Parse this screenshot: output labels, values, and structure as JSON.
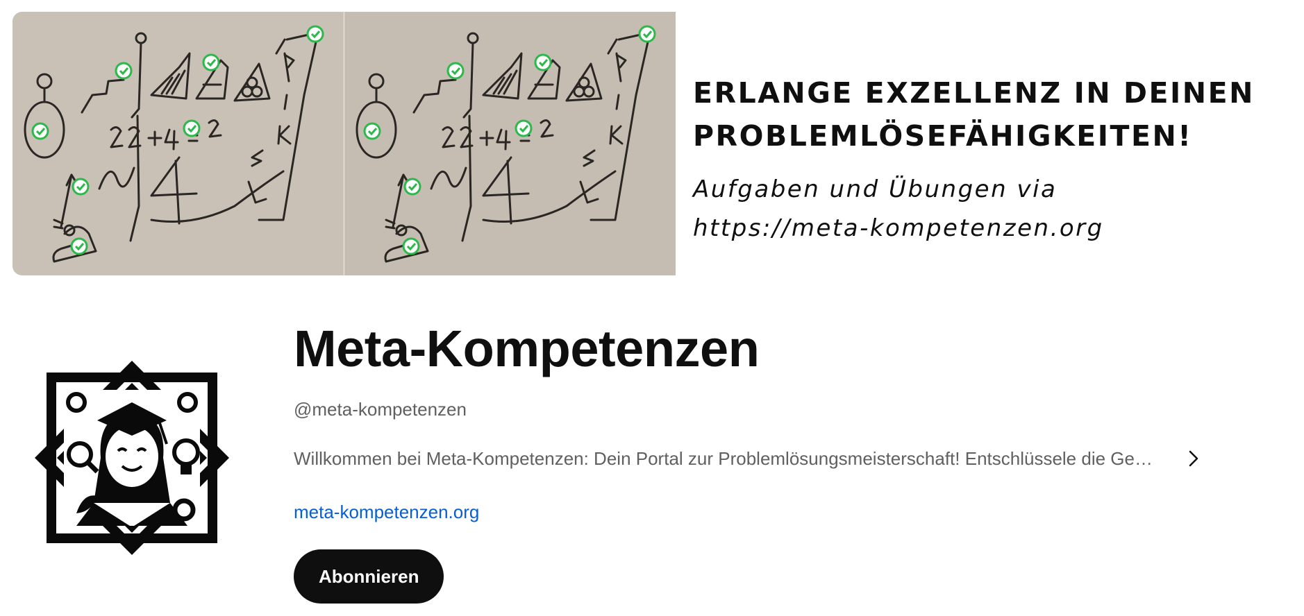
{
  "banner": {
    "headline": "ERLANGE EXZELLENZ IN DEINEN PROBLEMLÖSEFÄHIGKEITEN!",
    "sub_line1": "Aufgaben und Übungen via",
    "sub_line2": "https://meta-kompetenzen.org",
    "sketch_text": "22 + 4 = 2",
    "sketch_letters": [
      "P",
      "I",
      "K",
      "E",
      "L"
    ]
  },
  "channel": {
    "name": "Meta-Kompetenzen",
    "handle": "@meta-kompetenzen",
    "description": "Willkommen bei Meta-Kompetenzen: Dein Portal zur Problemlösungsmeisterschaft! Entschlüssele die Geheimnisse erfolgreicher Problemlösung",
    "link": "meta-kompetenzen.org",
    "subscribe_label": "Abonnieren"
  },
  "colors": {
    "button_bg": "#0f0f0f",
    "link": "#065fd4",
    "secondary_text": "#606060",
    "check_green": "#2db84b",
    "paper": "#c8bfb4"
  },
  "icons": {
    "description_more": "chevron-right-icon",
    "checkmarks": "check-circle-icon"
  }
}
